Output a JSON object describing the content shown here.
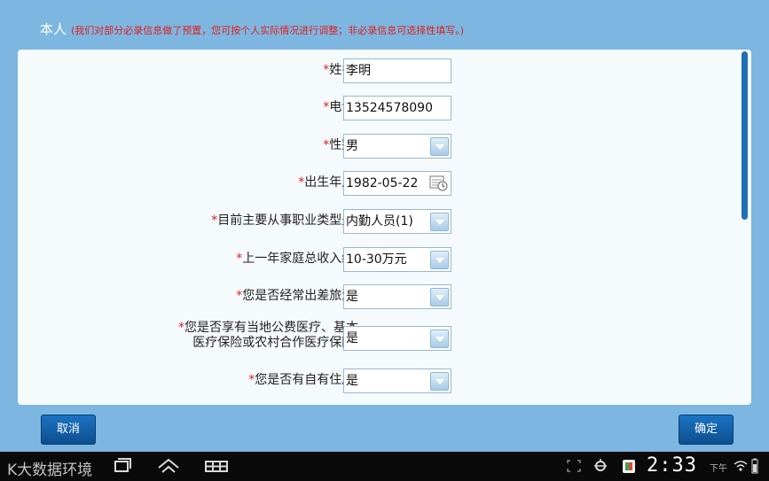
{
  "header": {
    "title": "本人",
    "note": "(我们对部分必录信息做了预置，您可按个人实际情况进行调整；非必录信息可选择性填写。)"
  },
  "form": {
    "required_mark": "*",
    "fields": [
      {
        "label": "姓名:",
        "value": "李明"
      },
      {
        "label": "电话:",
        "value": "13524578090"
      },
      {
        "label": "性别:",
        "value": "男"
      },
      {
        "label": "出生年月:",
        "value": "1982-05-22"
      },
      {
        "label": "目前主要从事职业类型是:",
        "value": "内勤人员(1)"
      },
      {
        "label": "上一年家庭总收入约:",
        "value": "10-30万元"
      },
      {
        "label": "您是否经常出差旅游:",
        "value": "是"
      },
      {
        "label_line1": "您是否享有当地公费医疗、基本",
        "label_line2": "医疗保险或农村合作医疗保险:",
        "value": "是"
      },
      {
        "label": "您是否有自有住房:",
        "value": "是"
      }
    ]
  },
  "buttons": {
    "cancel": "取消",
    "ok": "确定"
  },
  "statusbar": {
    "watermark": "K大数据环境",
    "time": "2:33",
    "ampm": "下午"
  },
  "colors": {
    "background": "#7db6e0",
    "panel": "#f5fafd",
    "required": "#e02020",
    "button": "#1565b0"
  }
}
